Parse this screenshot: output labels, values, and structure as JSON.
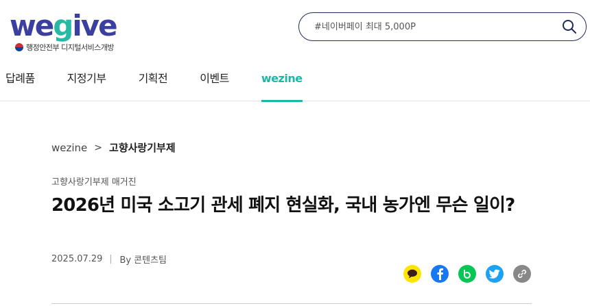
{
  "header": {
    "logo_text_left": "we",
    "logo_text_accent": "g",
    "logo_text_right": "ive",
    "logo_sub": "행정안전부 디지털서비스개방",
    "search_placeholder": "#네이버페이 최대 5,000P"
  },
  "nav": {
    "items": [
      {
        "label": "답례품"
      },
      {
        "label": "지정기부"
      },
      {
        "label": "기획전"
      },
      {
        "label": "이벤트"
      },
      {
        "label": "wezine"
      }
    ]
  },
  "breadcrumb": {
    "home": "wezine",
    "separator": ">",
    "current": "고향사랑기부제"
  },
  "article": {
    "category": "고향사랑기부제 매거진",
    "title": "2026년 미국 소고기 관세 폐지 현실화, 국내 농가엔 무슨 일이?",
    "date": "2025.07.29",
    "author": "By 콘텐츠팀"
  },
  "colors": {
    "brand": "#3a3fa0",
    "accent": "#1bb8a6",
    "kakao": "#fee500",
    "facebook": "#1877f2",
    "band": "#06c755",
    "twitter": "#1da1f2",
    "link": "#888888"
  },
  "share_icons": [
    "kakao-icon",
    "facebook-icon",
    "band-icon",
    "twitter-icon",
    "link-icon"
  ]
}
